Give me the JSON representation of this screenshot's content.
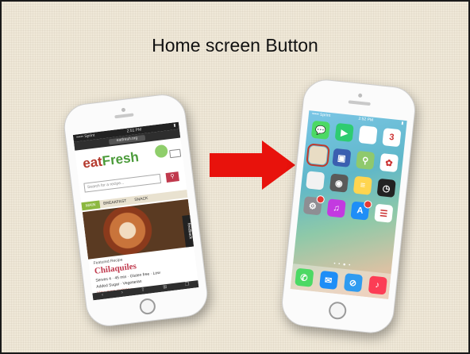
{
  "slide": {
    "title": "Home screen Button",
    "arrow_color": "#e8120c",
    "background_color": "#efe8d8"
  },
  "left_phone": {
    "status_left": "••••• Sprint",
    "status_time": "2:51 PM",
    "url": "eatfresh.org",
    "logo_part1": "eat",
    "logo_part2": "Fresh",
    "search_placeholder": "Search for a recipe...",
    "tabs": [
      "MAIN",
      "BREAKFAST",
      "SNACK"
    ],
    "feedback_label": "feedback",
    "recipe_category": "Featured Recipe",
    "recipe_name": "Chilaquiles",
    "recipe_line1": "Serves 4 · 45 min · Gluten free · Low",
    "recipe_line2": "Added Sugar · Vegetarian",
    "recipe_more": "View more recipes »",
    "toolbar_icons": [
      "back-icon",
      "forward-icon",
      "share-icon",
      "bookmarks-icon",
      "tabs-icon"
    ]
  },
  "right_phone": {
    "status_left": "••••• Sprint",
    "status_time": "2:52 PM",
    "apps": [
      {
        "name": "messages",
        "color": "#4cd964",
        "glyph": "💬"
      },
      {
        "name": "facetime",
        "color": "#2ecc71",
        "glyph": "▶"
      },
      {
        "name": "calendar",
        "color": "#ffffff",
        "glyph": ""
      },
      {
        "name": "calendar-day",
        "color": "#ffffff",
        "glyph": "3"
      },
      {
        "name": "eatfresh",
        "color": "#e8dcc4",
        "glyph": "",
        "highlight": true
      },
      {
        "name": "videos",
        "color": "#3b5fb0",
        "glyph": "▣"
      },
      {
        "name": "maps",
        "color": "#8fc96d",
        "glyph": "⚲"
      },
      {
        "name": "photos",
        "color": "#ffffff",
        "glyph": "✿"
      },
      {
        "name": "notes-blank",
        "color": "#f2f2f2",
        "glyph": ""
      },
      {
        "name": "camera",
        "color": "#5a5a5a",
        "glyph": "◉"
      },
      {
        "name": "notes",
        "color": "#ffd54f",
        "glyph": "≡"
      },
      {
        "name": "clock",
        "color": "#222222",
        "glyph": "◷"
      },
      {
        "name": "settings",
        "color": "#8e8e93",
        "glyph": "⚙",
        "badge": true
      },
      {
        "name": "itunes",
        "color": "#c33ae0",
        "glyph": "♫"
      },
      {
        "name": "app-store",
        "color": "#1e8ef7",
        "glyph": "A",
        "badge": true
      },
      {
        "name": "reminders",
        "color": "#ffffff",
        "glyph": "☰"
      }
    ],
    "page_dots": "• • ● •",
    "dock": [
      {
        "name": "phone",
        "color": "#4cd964",
        "glyph": "✆"
      },
      {
        "name": "mail",
        "color": "#1e8ef7",
        "glyph": "✉"
      },
      {
        "name": "safari",
        "color": "#2f9bf0",
        "glyph": "⊘"
      },
      {
        "name": "music",
        "color": "#fc3d55",
        "glyph": "♪"
      }
    ]
  }
}
